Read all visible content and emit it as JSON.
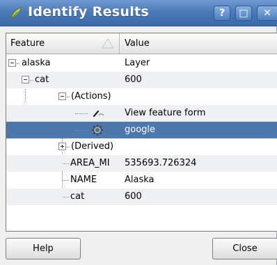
{
  "window": {
    "title": "Identify Results",
    "help_glyph": "?",
    "maximize_glyph": "□",
    "close_glyph": "✕"
  },
  "tree": {
    "columns": [
      "Feature",
      "Value"
    ],
    "rows": [
      {
        "feature": "alaska",
        "value": "Layer"
      },
      {
        "feature": "cat",
        "value": "600"
      },
      {
        "feature": "(Actions)",
        "value": ""
      },
      {
        "feature": "",
        "value": "View feature form",
        "icon": "edit-form-icon"
      },
      {
        "feature": "",
        "value": "google",
        "icon": "action-gear-icon",
        "selected": true
      },
      {
        "feature": "(Derived)",
        "value": ""
      },
      {
        "feature": "AREA_MI",
        "value": "535693.726324"
      },
      {
        "feature": "NAME",
        "value": "Alaska"
      },
      {
        "feature": "cat",
        "value": "600"
      }
    ]
  },
  "buttons": {
    "help": "Help",
    "close": "Close"
  },
  "colors": {
    "titlebar": "#4a7ab8",
    "selection": "#4d78ae",
    "alt_row": "#eef0f4"
  }
}
